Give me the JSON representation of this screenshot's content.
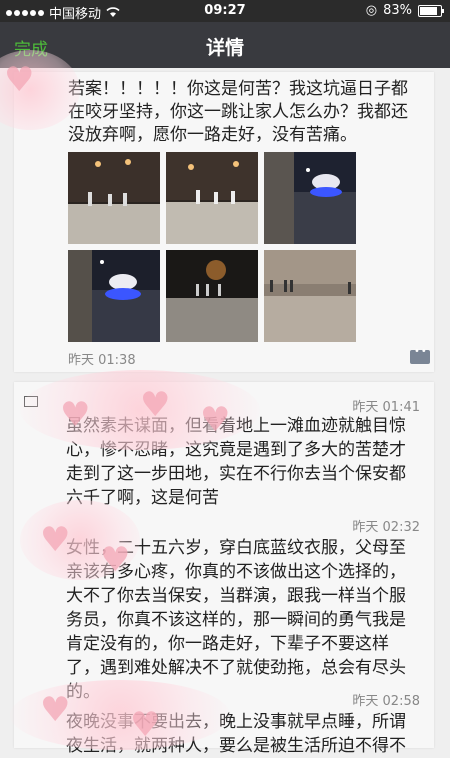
{
  "status_bar": {
    "carrier": "中国移动",
    "time": "09:27",
    "battery_percent": "83%",
    "battery_level": 0.83
  },
  "nav": {
    "back_label": "完成",
    "title": "详情"
  },
  "post": {
    "text": "若案！！！！！你这是何苦？我这坑逼日子都在咬牙坚持，你这一跳让家人怎么办？我都还没放弃啊，愿你一路走好，没有苦痛。",
    "time": "昨天 01:38",
    "photos": [
      {
        "icon": "photo-night-building-crowd"
      },
      {
        "icon": "photo-night-building-crowd"
      },
      {
        "icon": "photo-police-car-lights"
      },
      {
        "icon": "photo-police-car-lights"
      },
      {
        "icon": "photo-night-plaza-people"
      },
      {
        "icon": "photo-plaza-people"
      }
    ]
  },
  "comments": [
    {
      "time": "昨天 01:41",
      "text": "虽然素未谋面，但看着地上一滩血迹就触目惊心，惨不忍睹，这究竟是遇到了多大的苦楚才走到了这一步田地，实在不行你去当个保安都六千了啊，这是何苦"
    },
    {
      "time": "昨天 02:32",
      "text": "女性，二十五六岁，穿白底蓝纹衣服，父母至亲该有多心疼，你真的不该做出这个选择的，大不了你去当保安，当群演，跟我一样当个服务员，你真不该这样的，那一瞬间的勇气我是肯定没有的，你一路走好，下辈子不要这样了，遇到难处解决不了就使劲拖，总会有尽头的。"
    },
    {
      "time": "昨天 02:58",
      "text": "夜晚没事不要出去，晚上没事就早点睡，所谓夜生活，就两种人，要么是被生活所迫不得不"
    }
  ],
  "colors": {
    "nav_bg": "#393a3f",
    "accent": "#4dbb3a",
    "status_bg": "#2b2b2b"
  }
}
